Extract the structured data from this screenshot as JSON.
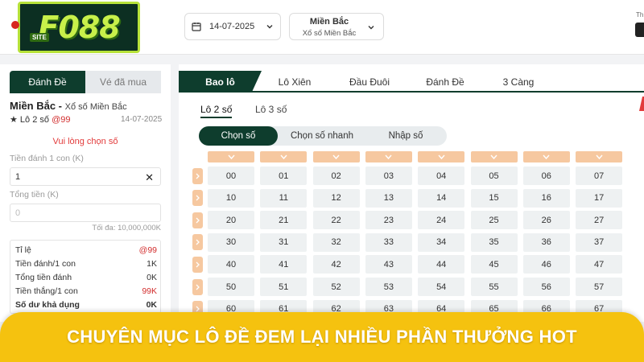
{
  "brand": {
    "logo_text": "F088",
    "logo_sub": "SITE"
  },
  "header": {
    "date": "14-07-2025",
    "region_title": "Miền Bắc",
    "region_sub": "Xổ số Miền Bắc",
    "right_text": "Th"
  },
  "left": {
    "tab_bet": "Đánh Đề",
    "tab_bought": "Vé đã mua",
    "region": "Miền Bắc -",
    "region_sub": "Xổ số Miền Bắc",
    "bet_type": "★ Lô 2 số",
    "bet_rate": "@99",
    "date": "14-07-2025",
    "warning": "Vui lòng chọn số",
    "amount_label": "Tiền đánh 1 con (K)",
    "amount_value": "1",
    "total_label": "Tổng tiền (K)",
    "total_placeholder": "0",
    "max_text": "Tối đa: 10,000,000K",
    "summary": [
      {
        "label": "Tỉ lệ",
        "value": "@99",
        "red": true,
        "bold": false
      },
      {
        "label": "Tiền đánh/1 con",
        "value": "1K",
        "red": false,
        "bold": false
      },
      {
        "label": "Tổng tiền đánh",
        "value": "0K",
        "red": false,
        "bold": false
      },
      {
        "label": "Tiền thắng/1 con",
        "value": "99K",
        "red": true,
        "bold": false
      },
      {
        "label": "Số dư khả dụng",
        "value": "0K",
        "red": false,
        "bold": true
      }
    ]
  },
  "right": {
    "tabs": [
      "Bao lô",
      "Lô Xiên",
      "Đầu Đuôi",
      "Đánh Đề",
      "3 Càng"
    ],
    "sub_tabs": [
      "Lô 2 số",
      "Lô 3 số"
    ],
    "modes": [
      "Chọn số",
      "Chọn số nhanh",
      "Nhập số"
    ],
    "numbers": [
      [
        "00",
        "01",
        "02",
        "03",
        "04",
        "05",
        "06",
        "07"
      ],
      [
        "10",
        "11",
        "12",
        "13",
        "14",
        "15",
        "16",
        "17"
      ],
      [
        "20",
        "21",
        "22",
        "23",
        "24",
        "25",
        "26",
        "27"
      ],
      [
        "30",
        "31",
        "32",
        "33",
        "34",
        "35",
        "36",
        "37"
      ],
      [
        "40",
        "41",
        "42",
        "43",
        "44",
        "45",
        "46",
        "47"
      ],
      [
        "50",
        "51",
        "52",
        "53",
        "54",
        "55",
        "56",
        "57"
      ],
      [
        "60",
        "61",
        "62",
        "63",
        "64",
        "65",
        "66",
        "67"
      ]
    ]
  },
  "banner": {
    "text": "CHUYÊN MỤC LÔ ĐỀ ĐEM LẠI NHIỀU PHẦN THƯỞNG HOT"
  },
  "colors": {
    "dark_green": "#0e3d2d",
    "peach": "#f6c8a0",
    "banner_yellow": "#f5c20f",
    "red": "#d22e2e"
  }
}
